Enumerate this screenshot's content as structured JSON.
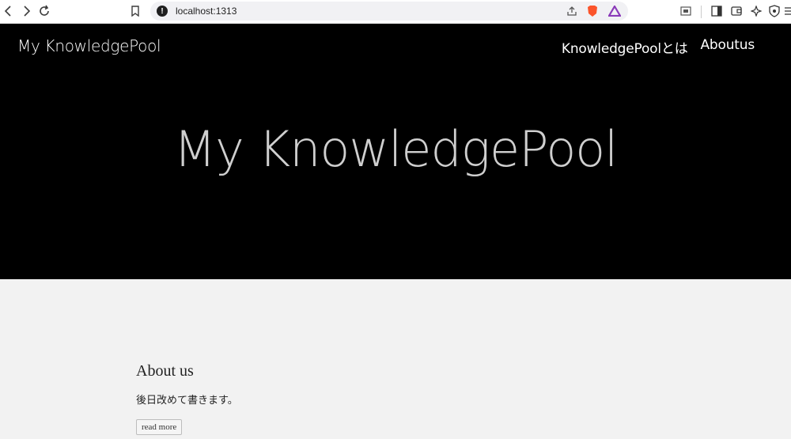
{
  "browser": {
    "url": "localhost:1313",
    "icons": {
      "back": "back-arrow-icon",
      "forward": "forward-arrow-icon",
      "reload": "reload-icon",
      "bookmark": "bookmark-icon",
      "site_info": "info-icon",
      "share": "share-icon",
      "brave_shield": "brave-lion-icon",
      "brave_rewards": "brave-rewards-triangle-icon",
      "screenshot": "screenshot-icon",
      "sidebar": "sidebar-icon",
      "wallet": "wallet-icon",
      "leo": "leo-ai-icon",
      "vpn": "vpn-shield-icon",
      "menu": "menu-icon"
    },
    "colors": {
      "brave_shield": "#fb542b",
      "rewards_triangle": "#8a3ab9"
    }
  },
  "site": {
    "brand": "My KnowledgePool",
    "nav": [
      {
        "label": "KnowledgePoolとは"
      },
      {
        "label": "Aboutus"
      }
    ],
    "hero_title": "My KnowledgePool",
    "colors": {
      "hero_background": "#000000",
      "page_background": "#f2f2f2"
    }
  },
  "section": {
    "heading": "About us",
    "text": "後日改めて書きます。",
    "button_label": "read more"
  }
}
